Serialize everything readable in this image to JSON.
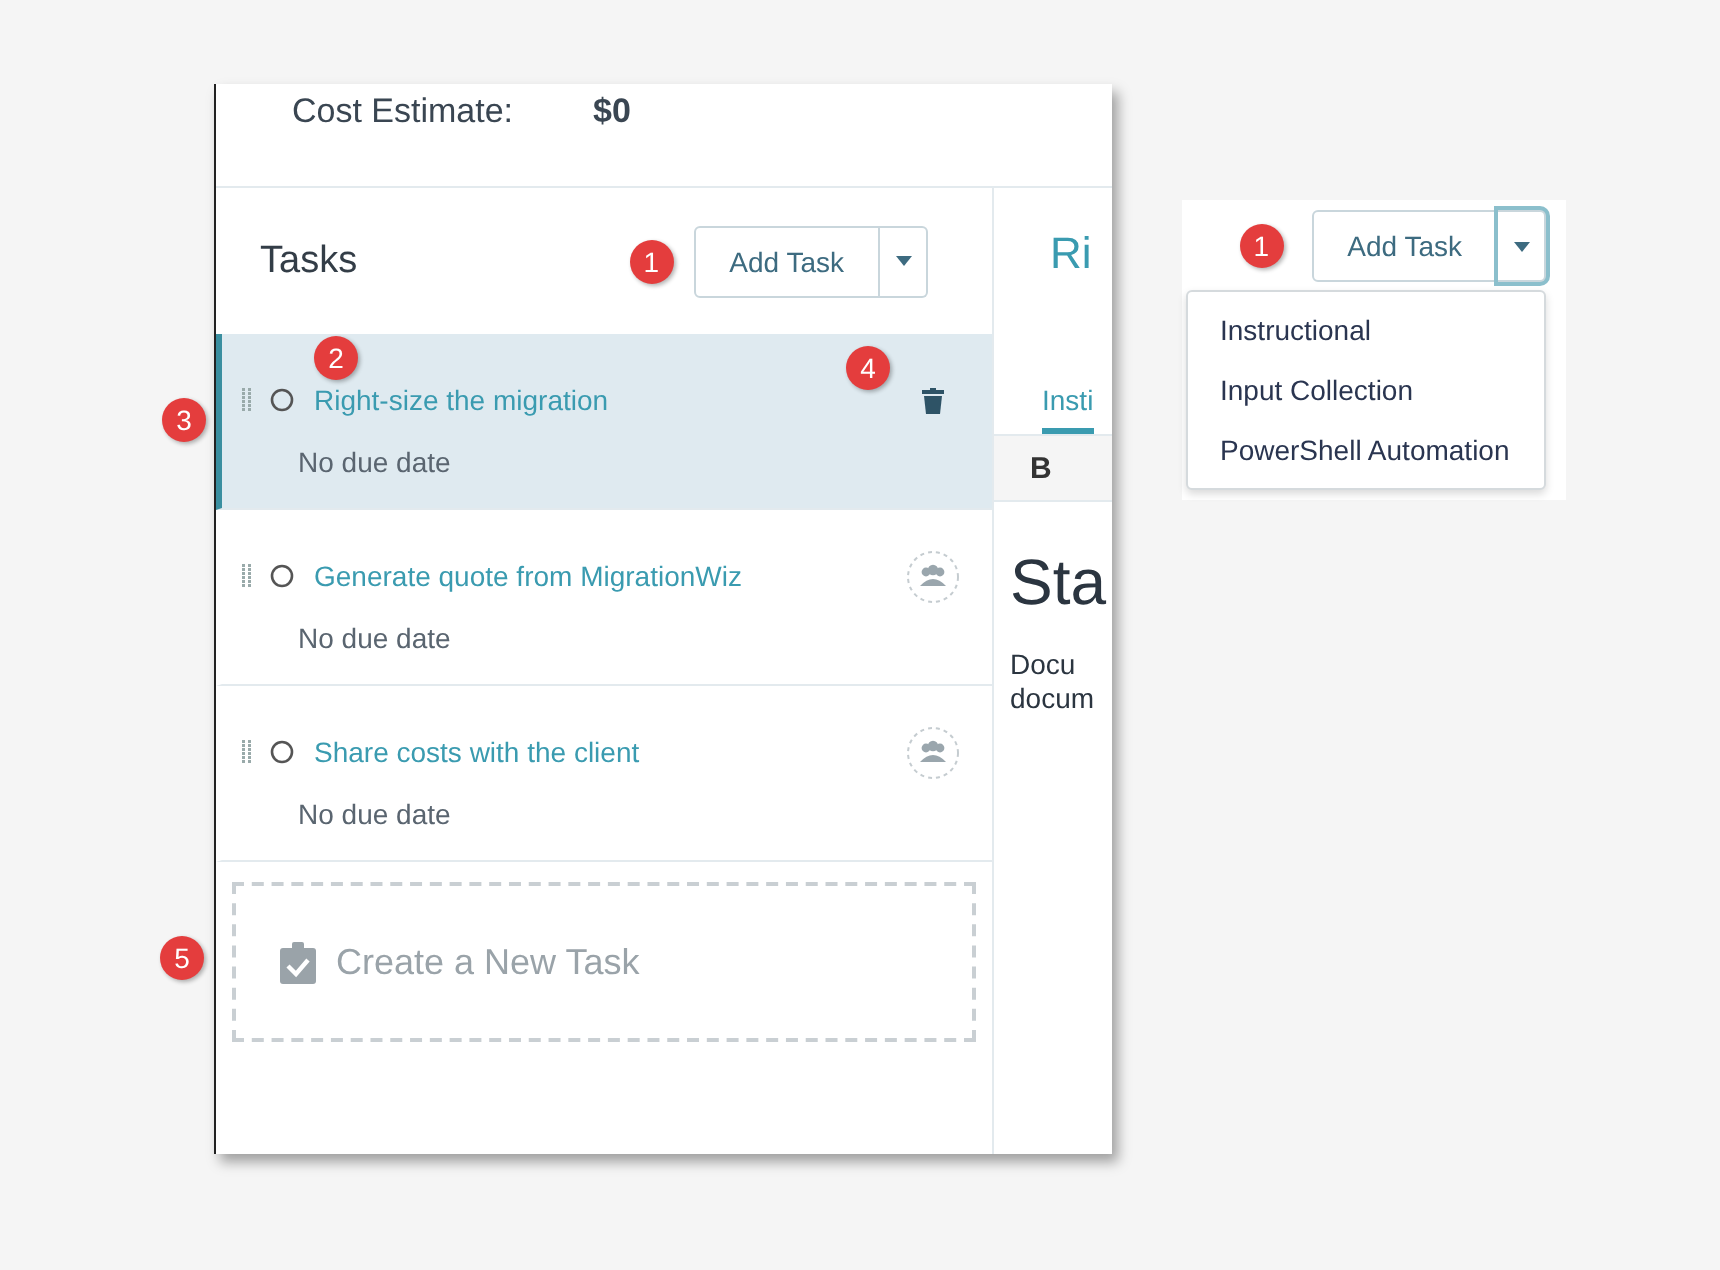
{
  "cost_bar": {
    "label": "Cost Estimate:",
    "value": "$0"
  },
  "tasks_panel": {
    "title": "Tasks",
    "add_button": "Add Task",
    "badge": "1",
    "tasks": [
      {
        "title": "Right-size the migration",
        "due": "No due date",
        "selected": true,
        "kind": "deletable",
        "badges": {
          "title": "2",
          "handle": "3",
          "action": "4"
        }
      },
      {
        "title": "Generate quote from MigrationWiz",
        "due": "No due date",
        "selected": false,
        "kind": "assignable"
      },
      {
        "title": "Share costs with the client",
        "due": "No due date",
        "selected": false,
        "kind": "assignable"
      }
    ],
    "create_task": {
      "label": "Create a New Task",
      "badge": "5"
    }
  },
  "detail_panel": {
    "title": "Ri",
    "tab": "Insti",
    "bold_button": "B",
    "heading": "Sta",
    "body_lines": [
      "Docu",
      "docum"
    ]
  },
  "dropdown_demo": {
    "button": "Add Task",
    "badge": "1",
    "options": [
      "Instructional",
      "Input Collection",
      "PowerShell Automation"
    ]
  }
}
